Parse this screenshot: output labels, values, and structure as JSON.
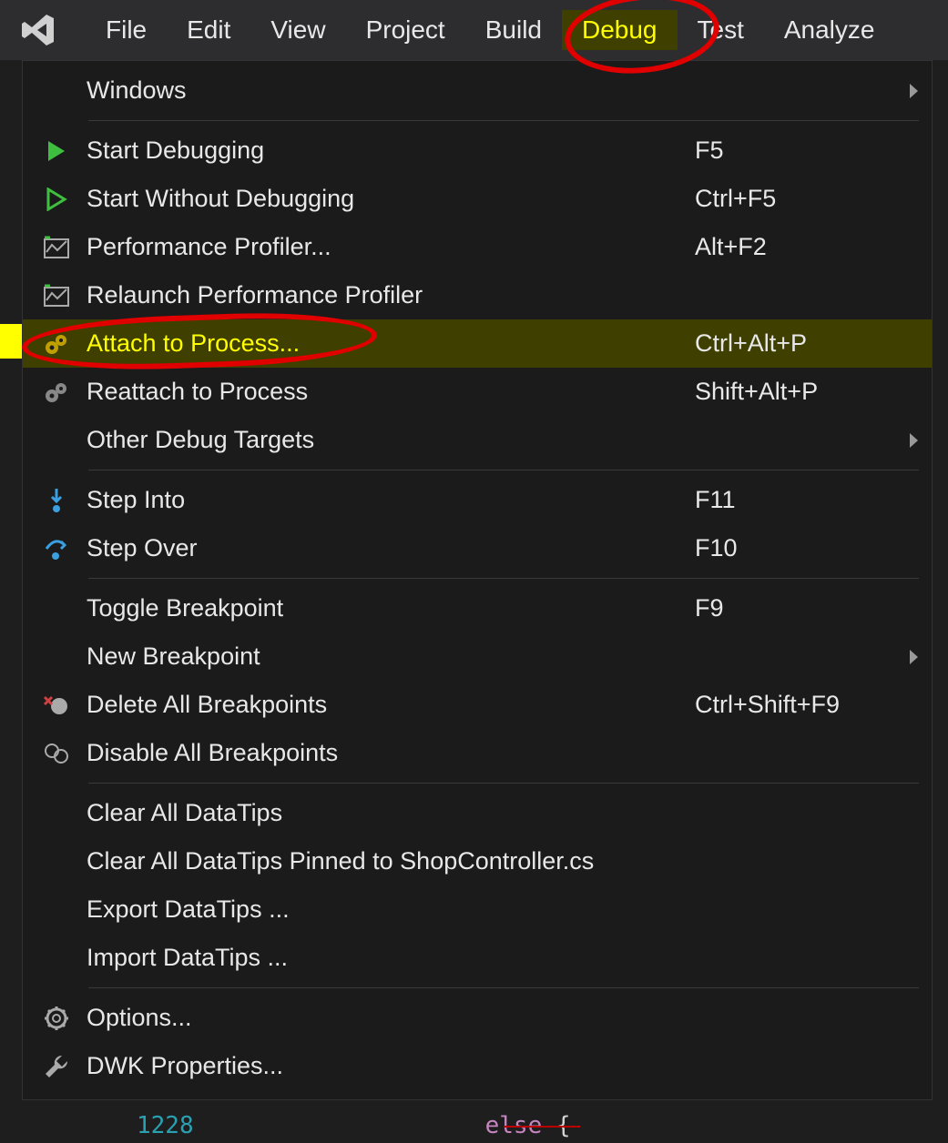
{
  "menubar": {
    "items": [
      {
        "label": "File"
      },
      {
        "label": "Edit"
      },
      {
        "label": "View"
      },
      {
        "label": "Project"
      },
      {
        "label": "Build"
      },
      {
        "label": "Debug"
      },
      {
        "label": "Test"
      },
      {
        "label": "Analyze"
      }
    ],
    "active_index": 5
  },
  "dropdown": {
    "items": [
      {
        "icon": "",
        "label": "Windows",
        "shortcut": "",
        "submenu": true
      },
      {
        "sep": true
      },
      {
        "icon": "play-solid",
        "label": "Start Debugging",
        "shortcut": "F5"
      },
      {
        "icon": "play-outline",
        "label": "Start Without Debugging",
        "shortcut": "Ctrl+F5"
      },
      {
        "icon": "profiler",
        "label": "Performance Profiler...",
        "shortcut": "Alt+F2"
      },
      {
        "icon": "profiler-relaunch",
        "label": "Relaunch Performance Profiler",
        "shortcut": ""
      },
      {
        "icon": "gears",
        "label": "Attach to Process...",
        "shortcut": "Ctrl+Alt+P",
        "highlighted": true
      },
      {
        "icon": "gears-gray",
        "label": "Reattach to Process",
        "shortcut": "Shift+Alt+P"
      },
      {
        "icon": "",
        "label": "Other Debug Targets",
        "shortcut": "",
        "submenu": true
      },
      {
        "sep": true
      },
      {
        "icon": "step-into",
        "label": "Step Into",
        "shortcut": "F11"
      },
      {
        "icon": "step-over",
        "label": "Step Over",
        "shortcut": "F10"
      },
      {
        "sep": true
      },
      {
        "icon": "",
        "label": "Toggle Breakpoint",
        "shortcut": "F9"
      },
      {
        "icon": "",
        "label": "New Breakpoint",
        "shortcut": "",
        "submenu": true
      },
      {
        "icon": "delete-bp",
        "label": "Delete All Breakpoints",
        "shortcut": "Ctrl+Shift+F9"
      },
      {
        "icon": "disable-bp",
        "label": "Disable All Breakpoints",
        "shortcut": ""
      },
      {
        "sep": true
      },
      {
        "icon": "",
        "label": "Clear All DataTips",
        "shortcut": ""
      },
      {
        "icon": "",
        "label": "Clear All DataTips Pinned to ShopController.cs",
        "shortcut": ""
      },
      {
        "icon": "",
        "label": "Export DataTips ...",
        "shortcut": ""
      },
      {
        "icon": "",
        "label": "Import DataTips ...",
        "shortcut": ""
      },
      {
        "sep": true
      },
      {
        "icon": "gear",
        "label": "Options...",
        "shortcut": ""
      },
      {
        "icon": "wrench",
        "label": "DWK Properties...",
        "shortcut": ""
      }
    ]
  },
  "editor": {
    "line_number": "1228",
    "code_fragment_keyword": "else",
    "code_fragment_rest": " {"
  }
}
